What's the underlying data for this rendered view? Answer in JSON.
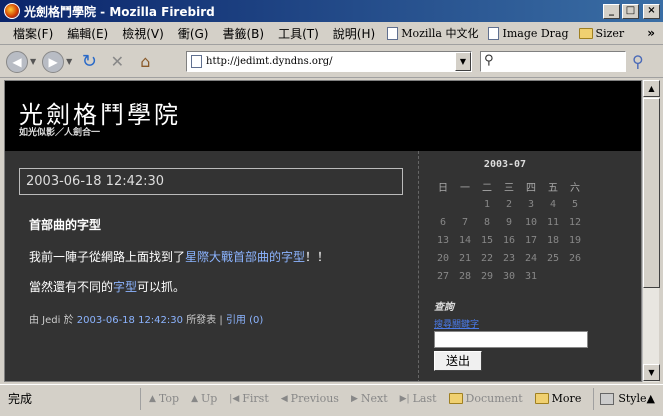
{
  "window": {
    "title": "光劍格鬥學院 - Mozilla Firebird"
  },
  "menu": [
    "檔案(F)",
    "編輯(E)",
    "檢視(V)",
    "衝(G)",
    "書籤(B)",
    "工具(T)",
    "說明(H)"
  ],
  "bookmarks": [
    {
      "label": "Mozilla 中文化",
      "icon": "page-icon"
    },
    {
      "label": "Image Drag",
      "icon": "page-icon"
    },
    {
      "label": "Sizer",
      "icon": "folder-icon"
    }
  ],
  "chevron": "»",
  "address": {
    "url": "http://jedimt.dyndns.org/"
  },
  "site": {
    "title": "光劍格鬥學院",
    "subtitle": "如光似影／人劍合一"
  },
  "post": {
    "date": "2003-06-18 12:42:30",
    "title": "首部曲的字型",
    "line1_pre": "我前一陣子從網路上面找到了",
    "line1_link": "星際大戰首部曲的字型",
    "line1_post": "！！",
    "line2_pre": "當然還有不同的",
    "line2_link": "字型",
    "line2_post": "可以抓。",
    "footer_pre": "由 Jedi 於",
    "footer_link": "2003-06-18 12:42:30",
    "footer_published": "所發表",
    "footer_sep": "|",
    "footer_comments": "引用 (0)"
  },
  "calendar": {
    "caption": "2003-07",
    "weekdays": [
      "日",
      "一",
      "二",
      "三",
      "四",
      "五",
      "六"
    ],
    "weeks": [
      [
        "",
        "",
        "1",
        "2",
        "3",
        "4",
        "5"
      ],
      [
        "6",
        "7",
        "8",
        "9",
        "10",
        "11",
        "12"
      ],
      [
        "13",
        "14",
        "15",
        "16",
        "17",
        "18",
        "19"
      ],
      [
        "20",
        "21",
        "22",
        "23",
        "24",
        "25",
        "26"
      ],
      [
        "27",
        "28",
        "29",
        "30",
        "31",
        "",
        ""
      ]
    ]
  },
  "search": {
    "heading": "查詢",
    "link": "搜尋關鍵字",
    "button": "送出"
  },
  "status": {
    "text": "完成"
  },
  "linkbar": [
    {
      "label": "Top",
      "glyph": "▲",
      "active": false
    },
    {
      "label": "Up",
      "glyph": "▲",
      "active": false
    },
    {
      "label": "First",
      "glyph": "|◀",
      "active": false
    },
    {
      "label": "Previous",
      "glyph": "◀",
      "active": false
    },
    {
      "label": "Next",
      "glyph": "▶",
      "active": false
    },
    {
      "label": "Last",
      "glyph": "▶|",
      "active": false
    },
    {
      "label": "Document",
      "glyph": "",
      "active": false
    },
    {
      "label": "More",
      "glyph": "",
      "active": true
    }
  ],
  "style_label": "Style▲"
}
